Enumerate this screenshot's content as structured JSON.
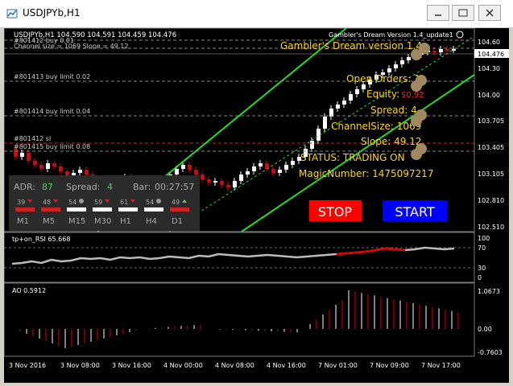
{
  "window": {
    "title": "USDJPYb,H1"
  },
  "chart": {
    "header_line": "USDJPYb,H1  104.590 104.591 104.459 104.476",
    "ea_name": "Gambler's Dream  Version 1.4_update1",
    "channel_info": "Channel size = 1069 Slope = 49.12",
    "orders": [
      {
        "id": "#801412 buy 0.01"
      },
      {
        "id": "#801413 buy limit 0.02"
      },
      {
        "id": "#801414 buy limit 0.04"
      },
      {
        "id": "#801412 sl"
      },
      {
        "id": "#801415 buy limit 0.08"
      }
    ],
    "overlay": {
      "title": "Gambler's Dream version 1.4",
      "open_orders": "Open Orders: 1",
      "equity": "Equity: ",
      "equity_value": "$0.92",
      "spread": "Spread: 4",
      "channel_size": "ChannelSize: 1069",
      "slope": "Slope: 49.12",
      "status": "STATUS: TRADING ON",
      "magic": "MagicNumber: 1475097217"
    },
    "buttons": {
      "stop": "STOP",
      "start": "START"
    },
    "price_axis": [
      "104.60",
      "104.476",
      "104.30",
      "104.00",
      "103.705",
      "103.405",
      "103.105",
      "102.810",
      "102.510"
    ],
    "current_price": "104.476"
  },
  "panel": {
    "adr_label": "ADR:",
    "adr_value": "87",
    "spread_label": "Spread:",
    "spread_value": "4",
    "bar_label": "Bar:",
    "bar_value": "00:27:57",
    "timeframes": [
      {
        "tf": "M1",
        "val": "39",
        "dir": "down",
        "color": "#d02020"
      },
      {
        "tf": "M5",
        "val": "48",
        "dir": "down",
        "color": "#d02020"
      },
      {
        "tf": "M15",
        "val": "54",
        "dir": "neutral",
        "color": "#ffffff"
      },
      {
        "tf": "M30",
        "val": "59",
        "dir": "down",
        "color": "#ffffff"
      },
      {
        "tf": "H1",
        "val": "61",
        "dir": "down",
        "color": "#ffffff"
      },
      {
        "tf": "H4",
        "val": "54",
        "dir": "neutral",
        "color": "#ffffff"
      },
      {
        "tf": "D1",
        "val": "49",
        "dir": "up",
        "color": "#d02020"
      }
    ]
  },
  "rsi": {
    "label": "tp+on_RSI 65.668",
    "levels": [
      "100",
      "70",
      "30",
      "0"
    ]
  },
  "ao": {
    "label": "AO 0.5912",
    "levels": [
      "1.0673",
      "0.00",
      "-0.7603"
    ]
  },
  "time_axis": [
    "3 Nov 2016",
    "3 Nov 08:00",
    "3 Nov 16:00",
    "4 Nov 00:00",
    "4 Nov 08:00",
    "4 Nov 16:00",
    "7 Nov 01:00",
    "7 Nov 09:00",
    "7 Nov 17:00"
  ],
  "colors": {
    "bull": "#ffffff",
    "bear": "#e00000",
    "channel": "#22dd22",
    "overlay_text": "#ffd700",
    "stop_bg": "#ff0000",
    "start_bg": "#0000ff"
  }
}
